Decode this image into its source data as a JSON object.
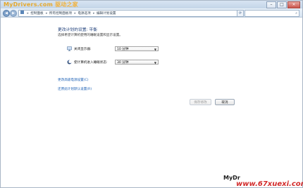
{
  "chrome": {
    "brand": {
      "site": "MyDrivers.com",
      "cn": "驱动之家"
    },
    "window_buttons": {
      "min": "–",
      "max": "□",
      "close": "×"
    }
  },
  "navbar": {
    "back": "◀",
    "forward": "▶",
    "breadcrumb": [
      "控制面板",
      "所有控制面板项",
      "电源选项",
      "编辑计划设置"
    ],
    "breadcrumb_separator": "▸",
    "refresh": "⟳",
    "search_icon": "⌕"
  },
  "content": {
    "title": "更改计划的设置: 平衡",
    "description": "选择希望计算机使用的睡眠设置和显示设置。",
    "settings": [
      {
        "label": "关闭显示器:",
        "value": "10 分钟",
        "icon": "monitor-icon"
      },
      {
        "label": "使计算机进入睡眠状态:",
        "value": "30 分钟",
        "icon": "sleep-moon-icon"
      }
    ],
    "links": {
      "advanced": "更改高级电源设置(C)",
      "restore": "还原此计划默认设置(R)"
    },
    "buttons": {
      "save": "保存修改",
      "cancel": "取消"
    }
  },
  "watermarks": {
    "mark1": "MyDr",
    "mark2": "www.67xuexi.com"
  },
  "colors": {
    "title_blue": "#1f3f7a",
    "link_blue": "#1a5fb4",
    "brand_orange": "#e6a92d",
    "watermark_red": "#d22b2b"
  }
}
